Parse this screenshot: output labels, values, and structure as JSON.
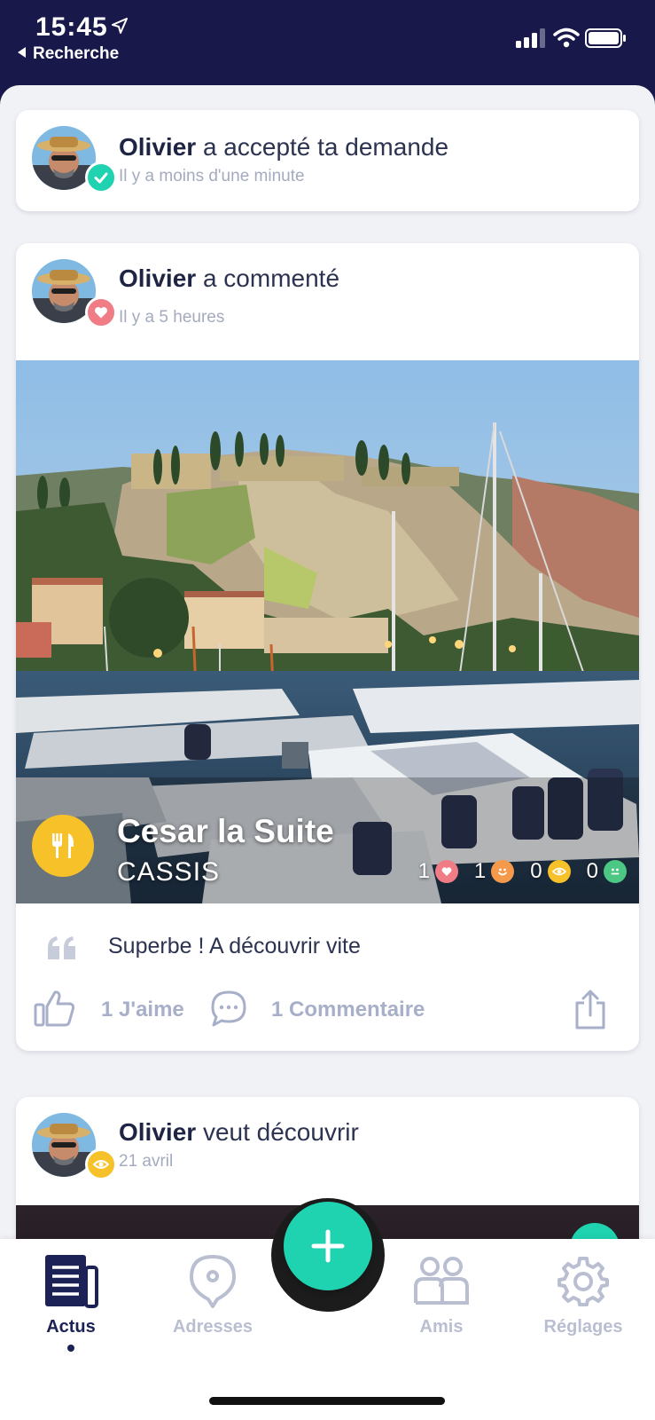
{
  "status_bar": {
    "time": "15:45",
    "back_label": "Recherche",
    "icons": [
      "location-arrow-icon",
      "signal-icon",
      "wifi-icon",
      "battery-icon"
    ]
  },
  "feed": [
    {
      "author": "Olivier",
      "action": "a accepté ta demande",
      "time": "Il y a moins d'une minute",
      "badge_icon": "check-icon",
      "badge_color": "#1fd3b0"
    },
    {
      "author": "Olivier",
      "action": "a commenté",
      "time": "Il y a 5 heures",
      "badge_icon": "heart-icon",
      "badge_color": "#f07d86",
      "place": {
        "name": "Cesar la Suite",
        "city": "CASSIS",
        "category_icon": "fork-knife-icon",
        "category_color": "#f7c12a",
        "stats": [
          {
            "count": "1",
            "icon": "heart-icon",
            "color": "#f07d86"
          },
          {
            "count": "1",
            "icon": "smile-icon",
            "color": "#f59a4a"
          },
          {
            "count": "0",
            "icon": "eye-icon",
            "color": "#f7c12a"
          },
          {
            "count": "0",
            "icon": "meh-icon",
            "color": "#4cc784"
          }
        ]
      },
      "comment": "Superbe ! A découvrir vite",
      "likes_label": "1 J'aime",
      "comments_label": "1 Commentaire"
    },
    {
      "author": "Olivier",
      "action": "veut découvrir",
      "time": "21 avril",
      "badge_icon": "eye-icon",
      "badge_color": "#f7c12a"
    }
  ],
  "tabbar": {
    "tabs": [
      {
        "label": "Actus",
        "icon": "news-icon",
        "active": true
      },
      {
        "label": "Adresses",
        "icon": "location-pin-icon",
        "active": false
      },
      {
        "label": "Amis",
        "icon": "friends-icon",
        "active": false
      },
      {
        "label": "Réglages",
        "icon": "gear-icon",
        "active": false
      }
    ],
    "fab_icon": "plus-icon",
    "fab_color": "#1fd3b0"
  },
  "colors": {
    "navy": "#18184a",
    "teal": "#1fd3b0",
    "muted": "#a7afc9"
  }
}
